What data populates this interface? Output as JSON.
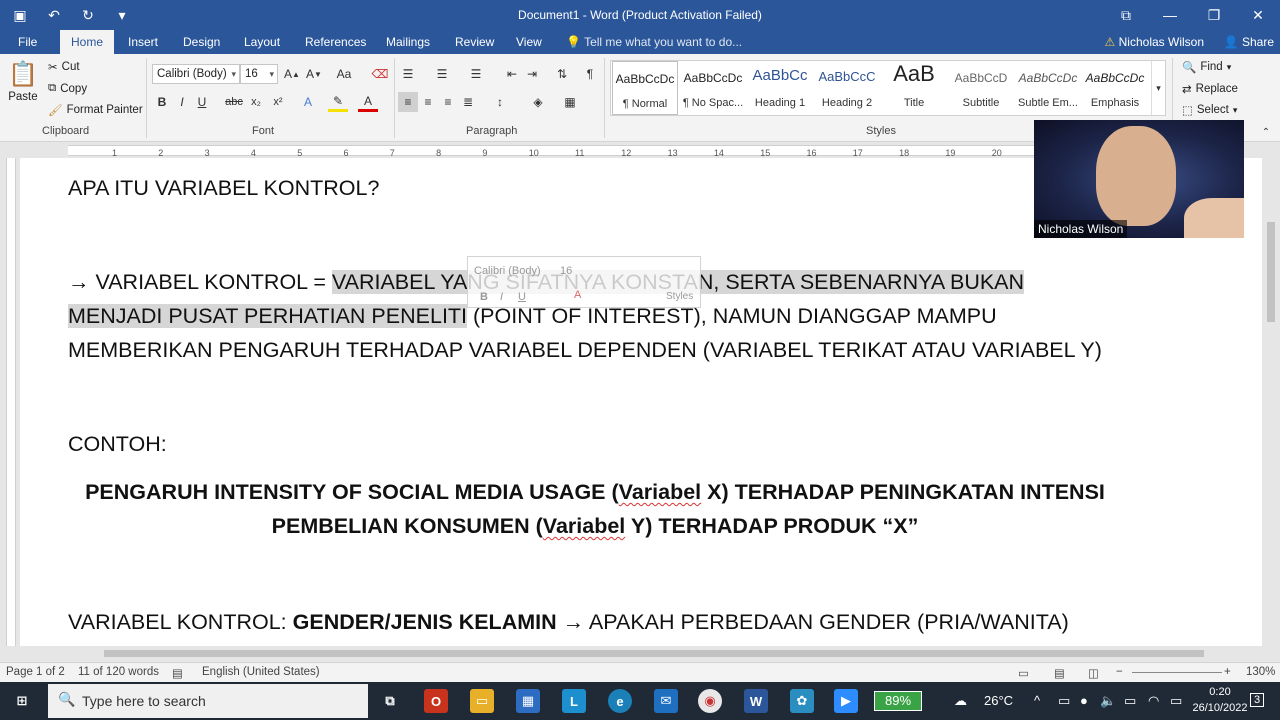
{
  "window": {
    "title": "Document1 - Word (Product Activation Failed)"
  },
  "ribbon_tabs": [
    "File",
    "Home",
    "Insert",
    "Design",
    "Layout",
    "References",
    "Mailings",
    "Review",
    "View"
  ],
  "tell_me": "Tell me what you want to do...",
  "user_name": "Nicholas Wilson",
  "share_label": "Share",
  "clipboard": {
    "paste": "Paste",
    "cut": "Cut",
    "copy": "Copy",
    "format_painter": "Format Painter",
    "group": "Clipboard"
  },
  "font": {
    "name": "Calibri (Body)",
    "size": "16",
    "group": "Font"
  },
  "paragraph": {
    "group": "Paragraph"
  },
  "styles": {
    "group": "Styles",
    "items": [
      {
        "preview": "AaBbCcDc",
        "name": "¶ Normal"
      },
      {
        "preview": "AaBbCcDc",
        "name": "¶ No Spac..."
      },
      {
        "preview": "AaBbCc",
        "name": "Heading 1"
      },
      {
        "preview": "AaBbCcC",
        "name": "Heading 2"
      },
      {
        "preview": "AaB",
        "name": "Title"
      },
      {
        "preview": "AaBbCcD",
        "name": "Subtitle"
      },
      {
        "preview": "AaBbCcDc",
        "name": "Subtle Em..."
      },
      {
        "preview": "AaBbCcDc",
        "name": "Emphasis"
      }
    ]
  },
  "editing": {
    "find": "Find",
    "replace": "Replace",
    "select": "Select"
  },
  "ruler_numbers": [
    "1",
    "2",
    "3",
    "4",
    "5",
    "6",
    "7",
    "8",
    "9",
    "10",
    "11",
    "12",
    "13",
    "14",
    "15",
    "16",
    "17",
    "18",
    "19",
    "20"
  ],
  "document": {
    "heading": "APA ITU VARIABEL KONTROL?",
    "def_prefix": "→ VARIABEL KONTROL = ",
    "def_highlight1": "VARIABEL YANG SIFATNYA KONSTAN, SERTA SEBENARNYA BUKAN",
    "def_highlight2": "MENJADI PUSAT PERHATIAN PENELITI",
    "def_rest2": " (POINT OF INTEREST), NAMUN DIANGGAP MAMPU",
    "def_line3": "MEMBERIKAN PENGARUH TERHADAP VARIABEL DEPENDEN (VARIABEL TERIKAT ATAU VARIABEL Y)",
    "contoh": "CONTOH:",
    "ex_line1_a": "PENGARUH INTENSITY OF SOCIAL MEDIA USAGE (",
    "ex_line1_b": "Variabel",
    "ex_line1_c": " X) TERHADAP PENINGKATAN INTENSI",
    "ex_line2_a": "PEMBELIAN KONSUMEN (",
    "ex_line2_b": "Variabel",
    "ex_line2_c": " Y) TERHADAP PRODUK “X”",
    "kontrol_a": "VARIABEL KONTROL: ",
    "kontrol_b": "GENDER/JENIS KELAMIN",
    "kontrol_c": " → APAKAH PERBEDAAN GENDER (PRIA/WANITA)"
  },
  "mini_toolbar": {
    "font": "Calibri (Body)",
    "size": "16",
    "styles": "Styles"
  },
  "webcam": {
    "name": "Nicholas Wilson"
  },
  "statusbar": {
    "page": "Page 1 of 2",
    "words": "11 of 120 words",
    "language": "English (United States)",
    "zoom": "130%"
  },
  "taskbar": {
    "search_placeholder": "Type here to search",
    "battery": "89%",
    "temperature": "26°C",
    "time": "0:20",
    "date": "26/10/2022",
    "notifications": "3"
  }
}
